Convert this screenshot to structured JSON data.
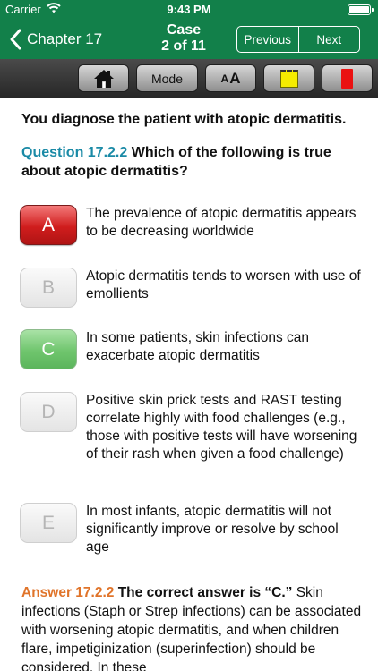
{
  "status": {
    "carrier": "Carrier",
    "time": "9:43 PM",
    "battery_level": 1.0
  },
  "nav": {
    "back_label": "Chapter 17",
    "title_line1": "Case",
    "title_line2": "2 of 11",
    "previous": "Previous",
    "next": "Next"
  },
  "toolbar": {
    "mode": "Mode",
    "font_small": "A",
    "font_large": "A",
    "highlight_color": "#f5ec00",
    "flag_color": "#ea1111"
  },
  "case_text": "You diagnose the patient with atopic dermatitis.",
  "question": {
    "number": "Question 17.2.2",
    "text": " Which of the following is true about atopic dermatitis?"
  },
  "options": [
    {
      "letter": "A",
      "state": "selected-wrong",
      "text": "The prevalence of atopic dermatitis appears to be decreasing worldwide"
    },
    {
      "letter": "B",
      "state": "inactive",
      "text": "Atopic dermatitis tends to worsen with use of emollients"
    },
    {
      "letter": "C",
      "state": "correct",
      "text": "In some patients, skin infections can exacerbate atopic dermatitis"
    },
    {
      "letter": "D",
      "state": "inactive",
      "text": "Positive skin prick tests and RAST testing correlate highly with food challenges (e.g., those with positive tests will have worsening of their rash when given a food challenge)"
    },
    {
      "letter": "E",
      "state": "inactive",
      "text": "In most infants, atopic dermatitis will not significantly improve or resolve by school age"
    }
  ],
  "answer": {
    "number": "Answer 17.2.2",
    "lead": " The correct answer is “C.”",
    "text": " Skin infections (Staph or Strep infections) can be associated with worsening atopic dermatitis, and when children flare, impetiginization (superinfection) should be considered. In these"
  },
  "colors": {
    "nav_green": "#12804a",
    "question_blue": "#1a8aa6",
    "answer_orange": "#e0742a"
  }
}
